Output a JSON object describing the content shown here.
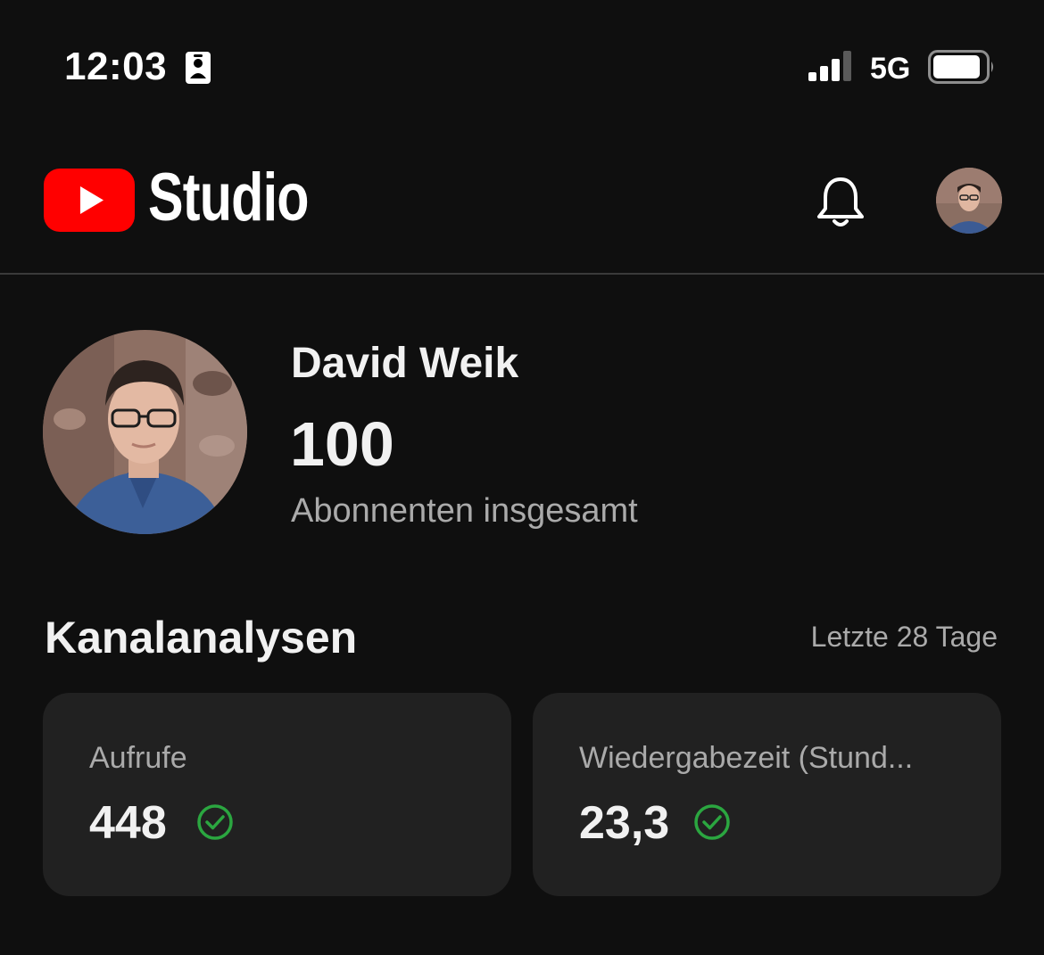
{
  "status_bar": {
    "time": "12:03",
    "network": "5G",
    "icons": [
      "contact-icon",
      "signal-icon",
      "battery-icon"
    ]
  },
  "header": {
    "brand": "Studio",
    "logo_icon": "youtube-play-icon",
    "notification_icon": "bell-icon",
    "avatar": "profile-avatar"
  },
  "channel": {
    "name": "David Weik",
    "subscribers": "100",
    "subscribers_label": "Abonnenten insgesamt"
  },
  "analytics": {
    "title": "Kanalanalysen",
    "period": "Letzte 28 Tage",
    "metrics": [
      {
        "label": "Aufrufe",
        "value": "448",
        "status_icon": "check-circle-icon"
      },
      {
        "label": "Wiedergabezeit (Stund...",
        "value": "23,3",
        "status_icon": "check-circle-icon"
      }
    ]
  },
  "colors": {
    "background": "#0f0f0f",
    "card": "#212121",
    "brand_red": "#ff0000",
    "check_green": "#2ba640",
    "muted_text": "#aaaaaa"
  }
}
